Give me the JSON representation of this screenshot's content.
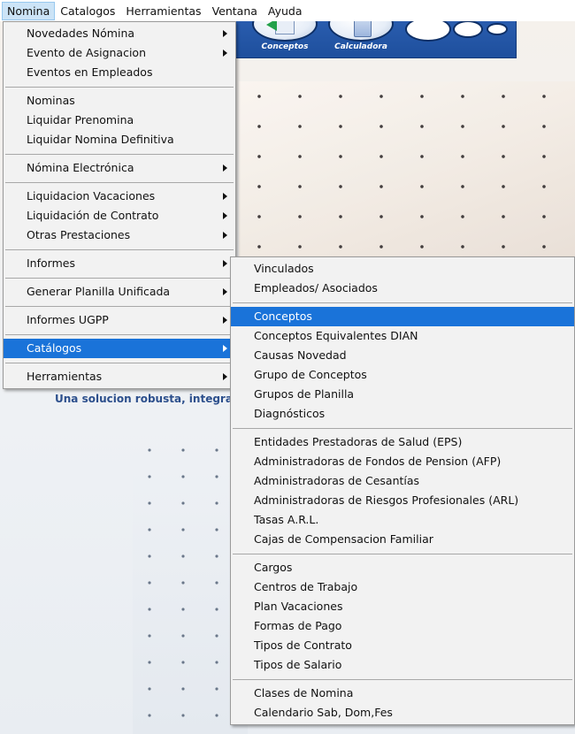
{
  "menubar": {
    "items": [
      "Nomina",
      "Catalogos",
      "Herramientas",
      "Ventana",
      "Ayuda"
    ]
  },
  "toolbar": {
    "conceptos_label": "Conceptos",
    "calculadora_label": "Calculadora"
  },
  "background": {
    "tagline": "Una solucion robusta, integral"
  },
  "nomina_menu": {
    "groups": [
      [
        {
          "label": "Novedades Nómina",
          "submenu": true
        },
        {
          "label": "Evento de Asignacion",
          "submenu": true
        },
        {
          "label": "Eventos en Empleados",
          "submenu": false
        }
      ],
      [
        {
          "label": "Nominas",
          "submenu": false
        },
        {
          "label": "Liquidar Prenomina",
          "submenu": false
        },
        {
          "label": "Liquidar Nomina Definitiva",
          "submenu": false
        }
      ],
      [
        {
          "label": "Nómina Electrónica",
          "submenu": true
        }
      ],
      [
        {
          "label": "Liquidacion Vacaciones",
          "submenu": true
        },
        {
          "label": "Liquidación de Contrato",
          "submenu": true
        },
        {
          "label": "Otras Prestaciones",
          "submenu": true
        }
      ],
      [
        {
          "label": "Informes",
          "submenu": true
        }
      ],
      [
        {
          "label": "Generar Planilla Unificada",
          "submenu": true
        }
      ],
      [
        {
          "label": "Informes UGPP",
          "submenu": true
        }
      ],
      [
        {
          "label": "Catálogos",
          "submenu": true,
          "highlight": true
        }
      ],
      [
        {
          "label": "Herramientas",
          "submenu": true
        }
      ]
    ]
  },
  "catalogos_submenu": {
    "groups": [
      [
        {
          "label": "Vinculados"
        },
        {
          "label": "Empleados/ Asociados"
        }
      ],
      [
        {
          "label": "Conceptos",
          "highlight": true
        },
        {
          "label": "Conceptos Equivalentes DIAN"
        },
        {
          "label": "Causas Novedad"
        },
        {
          "label": "Grupo de Conceptos"
        },
        {
          "label": "Grupos de Planilla"
        },
        {
          "label": "Diagnósticos"
        }
      ],
      [
        {
          "label": "Entidades Prestadoras de Salud (EPS)"
        },
        {
          "label": "Administradoras de Fondos de Pension (AFP)"
        },
        {
          "label": "Administradoras de Cesantías"
        },
        {
          "label": "Administradoras de Riesgos Profesionales (ARL)"
        },
        {
          "label": "Tasas A.R.L."
        },
        {
          "label": "Cajas de Compensacion Familiar"
        }
      ],
      [
        {
          "label": "Cargos"
        },
        {
          "label": "Centros de Trabajo"
        },
        {
          "label": "Plan Vacaciones"
        },
        {
          "label": "Formas de Pago"
        },
        {
          "label": "Tipos de Contrato"
        },
        {
          "label": "Tipos de Salario"
        }
      ],
      [
        {
          "label": "Clases de Nomina"
        },
        {
          "label": "Calendario Sab, Dom,Fes"
        }
      ]
    ]
  },
  "colors": {
    "highlight": "#1a73d9",
    "menubar_active": "#cce4f7",
    "toolbar": "#2f63b6"
  }
}
